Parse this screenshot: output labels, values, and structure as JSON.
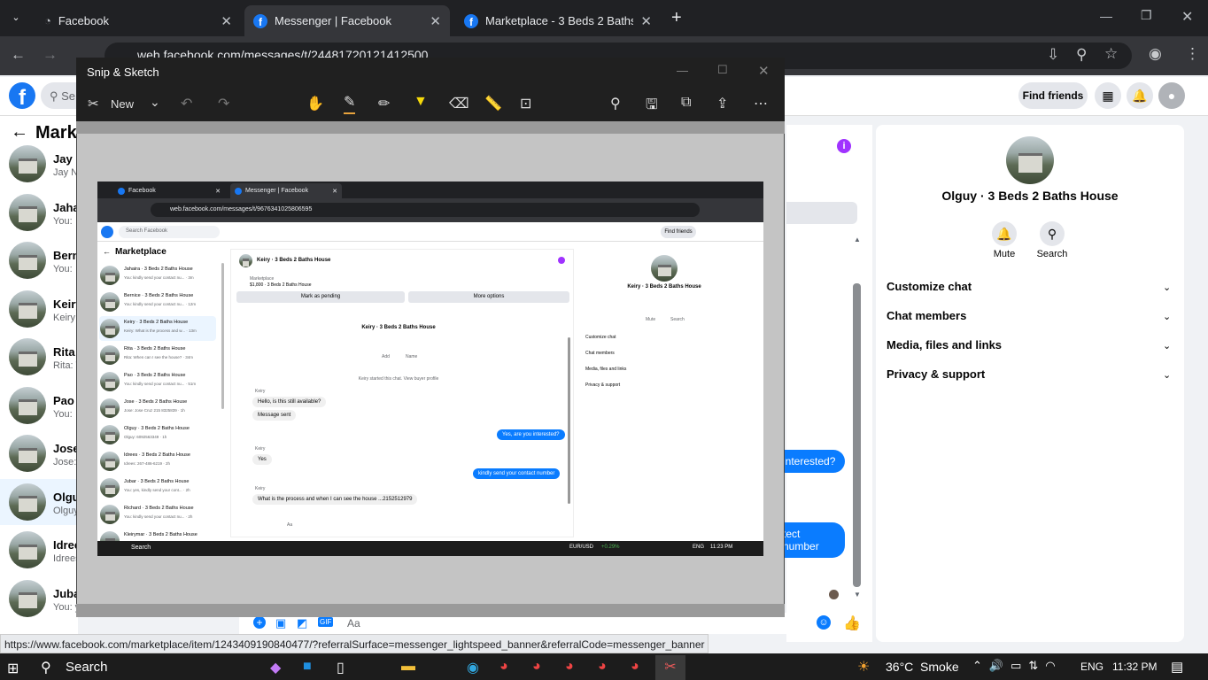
{
  "browser": {
    "tabs": [
      {
        "title": "Facebook"
      },
      {
        "title": "Messenger | Facebook"
      },
      {
        "title": "Marketplace - 3 Beds 2 Baths H"
      }
    ],
    "url": "web.facebook.com/messages/t/24481720121412500",
    "status_url": "https://www.facebook.com/marketplace/item/1243409190840477/?referralSurface=messenger_lightspeed_banner&referralCode=messenger_banner"
  },
  "facebook": {
    "search_placeholder": "Se",
    "find_friends": "Find friends",
    "back_title": "Marke",
    "conversations": [
      {
        "name": "Jay N",
        "sub": "Jay N"
      },
      {
        "name": "Jahai",
        "sub": "You:"
      },
      {
        "name": "Berni",
        "sub": "You:"
      },
      {
        "name": "Keiry",
        "sub": "Keiry:"
      },
      {
        "name": "Rita -",
        "sub": "Rita: W"
      },
      {
        "name": "Pao -",
        "sub": "You:"
      },
      {
        "name": "Jose",
        "sub": "Jose: J"
      },
      {
        "name": "Olgu",
        "sub": "Olguy"
      },
      {
        "name": "Idree",
        "sub": "Idrees"
      },
      {
        "name": "Jubar",
        "sub": "You: y"
      }
    ],
    "chat_bubbles": [
      " interested?",
      "tect number"
    ],
    "composer_placeholder": "Aa",
    "right_panel": {
      "name": "Olguy · 3 Beds 2 Baths House",
      "mute": "Mute",
      "search": "Search",
      "sections": [
        "Customize chat",
        "Chat members",
        "Media, files and links",
        "Privacy & support"
      ]
    }
  },
  "snip": {
    "title": "Snip & Sketch",
    "new_label": "New",
    "inner": {
      "tabs": [
        "Facebook",
        "Messenger | Facebook"
      ],
      "url": "web.facebook.com/messages/t/9676341025806595",
      "search_placeholder": "Search Facebook",
      "find_friends": "Find friends",
      "heading": "Marketplace",
      "list": [
        {
          "name": "Jahaira · 3 Beds 2 Baths House",
          "sub": "You: kindly send your contact nu... · 3m"
        },
        {
          "name": "Bernice · 3 Beds 2 Baths House",
          "sub": "You: kindly send your contact nu... · 12m"
        },
        {
          "name": "Keiry · 3 Beds 2 Baths House",
          "sub": "Keiry: What is the process and w... · 13m"
        },
        {
          "name": "Rita · 3 Beds 2 Baths House",
          "sub": "Rita: When can I see the house? · 34m"
        },
        {
          "name": "Pao · 3 Beds 2 Baths House",
          "sub": "You: kindly send your contact nu... · 51m"
        },
        {
          "name": "Jose · 3 Beds 2 Baths House",
          "sub": "Jose: Jose Cruz 215 8325839 · 1h"
        },
        {
          "name": "Olguy · 3 Beds 2 Baths House",
          "sub": "Olguy: 6092563349 · 1h"
        },
        {
          "name": "Idrees · 3 Beds 2 Baths House",
          "sub": "Idrees: 267-486-6219 · 2h"
        },
        {
          "name": "Jubar · 3 Beds 2 Baths House",
          "sub": "You: yes, kindly send your cont... · 2h"
        },
        {
          "name": "Richard · 3 Beds 2 Baths House",
          "sub": "You: kindly send your contact nu... · 2h"
        },
        {
          "name": "Kleirymar · 3 Beds 2 Baths House",
          "sub": ""
        }
      ],
      "chat_name": "Keiry · 3 Beds 2 Baths House",
      "listing_label": "Marketplace",
      "listing_price": "$1,800 · 3 Beds 2 Baths House",
      "mark_pending": "Mark as pending",
      "more_options": "More options",
      "center_name": "Keiry · 3 Beds 2 Baths House",
      "add": "Add",
      "name_label": "Name",
      "started": "Keiry started this chat. View buyer profile",
      "messages": [
        {
          "from": "Keiry",
          "text": "Hello, is this still available?",
          "me": false
        },
        {
          "from": "",
          "text": "Message sent",
          "me": false
        },
        {
          "from": "",
          "text": "Yes, are you interested?",
          "me": true
        },
        {
          "from": "Keiry",
          "text": "Yes",
          "me": false
        },
        {
          "from": "",
          "text": "kindly send your  contact number",
          "me": true
        },
        {
          "from": "Keiry",
          "text": "What is the process and when I can see the house ...2152512979",
          "me": false
        }
      ],
      "composer": "Aa",
      "right_name": "Keiry · 3 Beds 2 Baths House",
      "mute": "Mute",
      "search": "Search",
      "sections": [
        "Customize chat",
        "Chat members",
        "Media, files and links",
        "Privacy & support"
      ],
      "taskbar_search": "Search",
      "ticker": "EUR/USD",
      "ticker_change": "+0.29%",
      "lang": "ENG",
      "time": "11:23 PM"
    }
  },
  "taskbar": {
    "search": "Search",
    "weather": "36°C  Smoke",
    "lang": "ENG",
    "time": "11:32 PM"
  }
}
